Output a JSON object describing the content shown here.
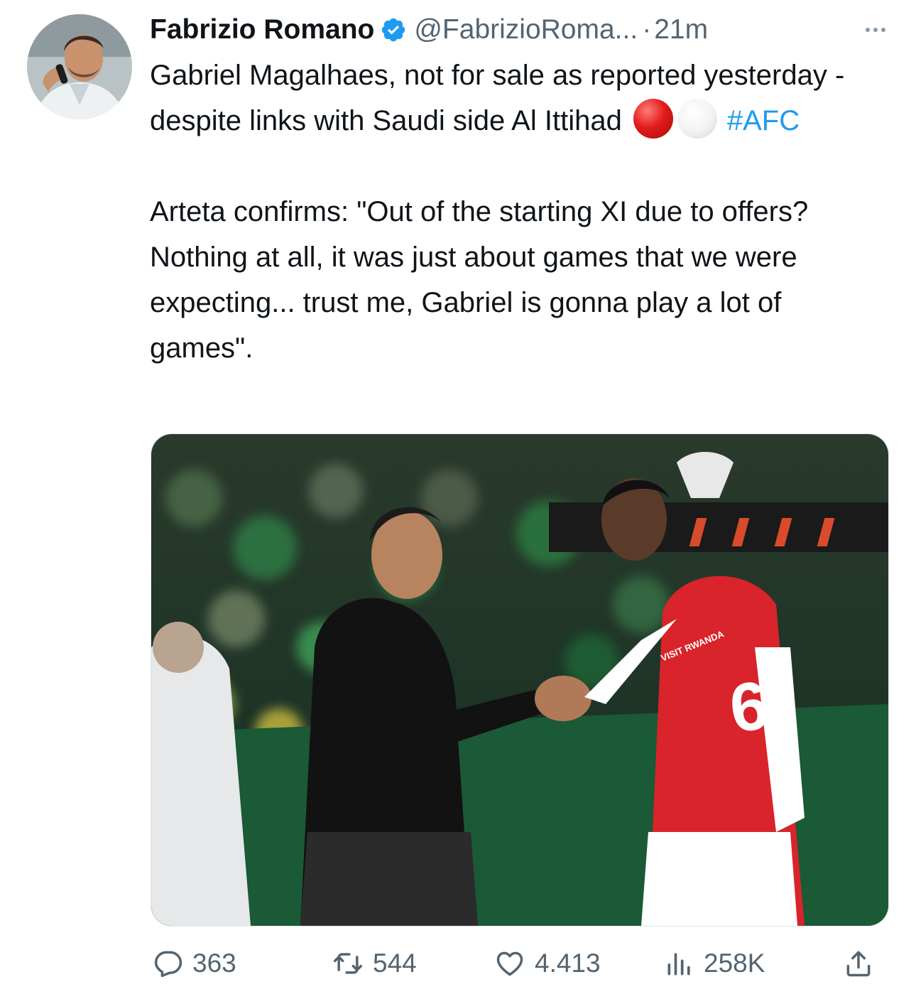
{
  "tweet": {
    "author": {
      "name": "Fabrizio Romano",
      "handle": "@FabrizioRoma...",
      "separator": "·",
      "time": "21m",
      "verified": true,
      "avatar": "author-photo"
    },
    "paragraph_1": {
      "text": "Gabriel Magalhaes, not for sale as reported yesterday - despite links with Saudi side Al Ittihad",
      "emoji": [
        "red-circle",
        "white-circle"
      ],
      "hashtag": "#AFC"
    },
    "paragraph_2": "Arteta confirms: \"Out of the starting XI due to offers? Nothing at all, it was just about games that we were expecting... trust me, Gabriel is gonna play a lot of games\".",
    "media": {
      "shirt_text": "VISIT RWANDA",
      "shirt_number": "6"
    },
    "metrics": {
      "replies": "363",
      "retweets": "544",
      "likes": "4.413",
      "views": "258K"
    }
  },
  "icons": {
    "more": "more-horizontal-icon",
    "reply": "speech-bubble-icon",
    "retweet": "retweet-arrows-icon",
    "like": "heart-icon",
    "views": "bar-chart-icon",
    "share": "upload-arrow-icon"
  },
  "colors": {
    "text": "#0f1419",
    "secondary": "#536471",
    "link": "#1d9bf0",
    "verified": "#1d9bf0"
  }
}
